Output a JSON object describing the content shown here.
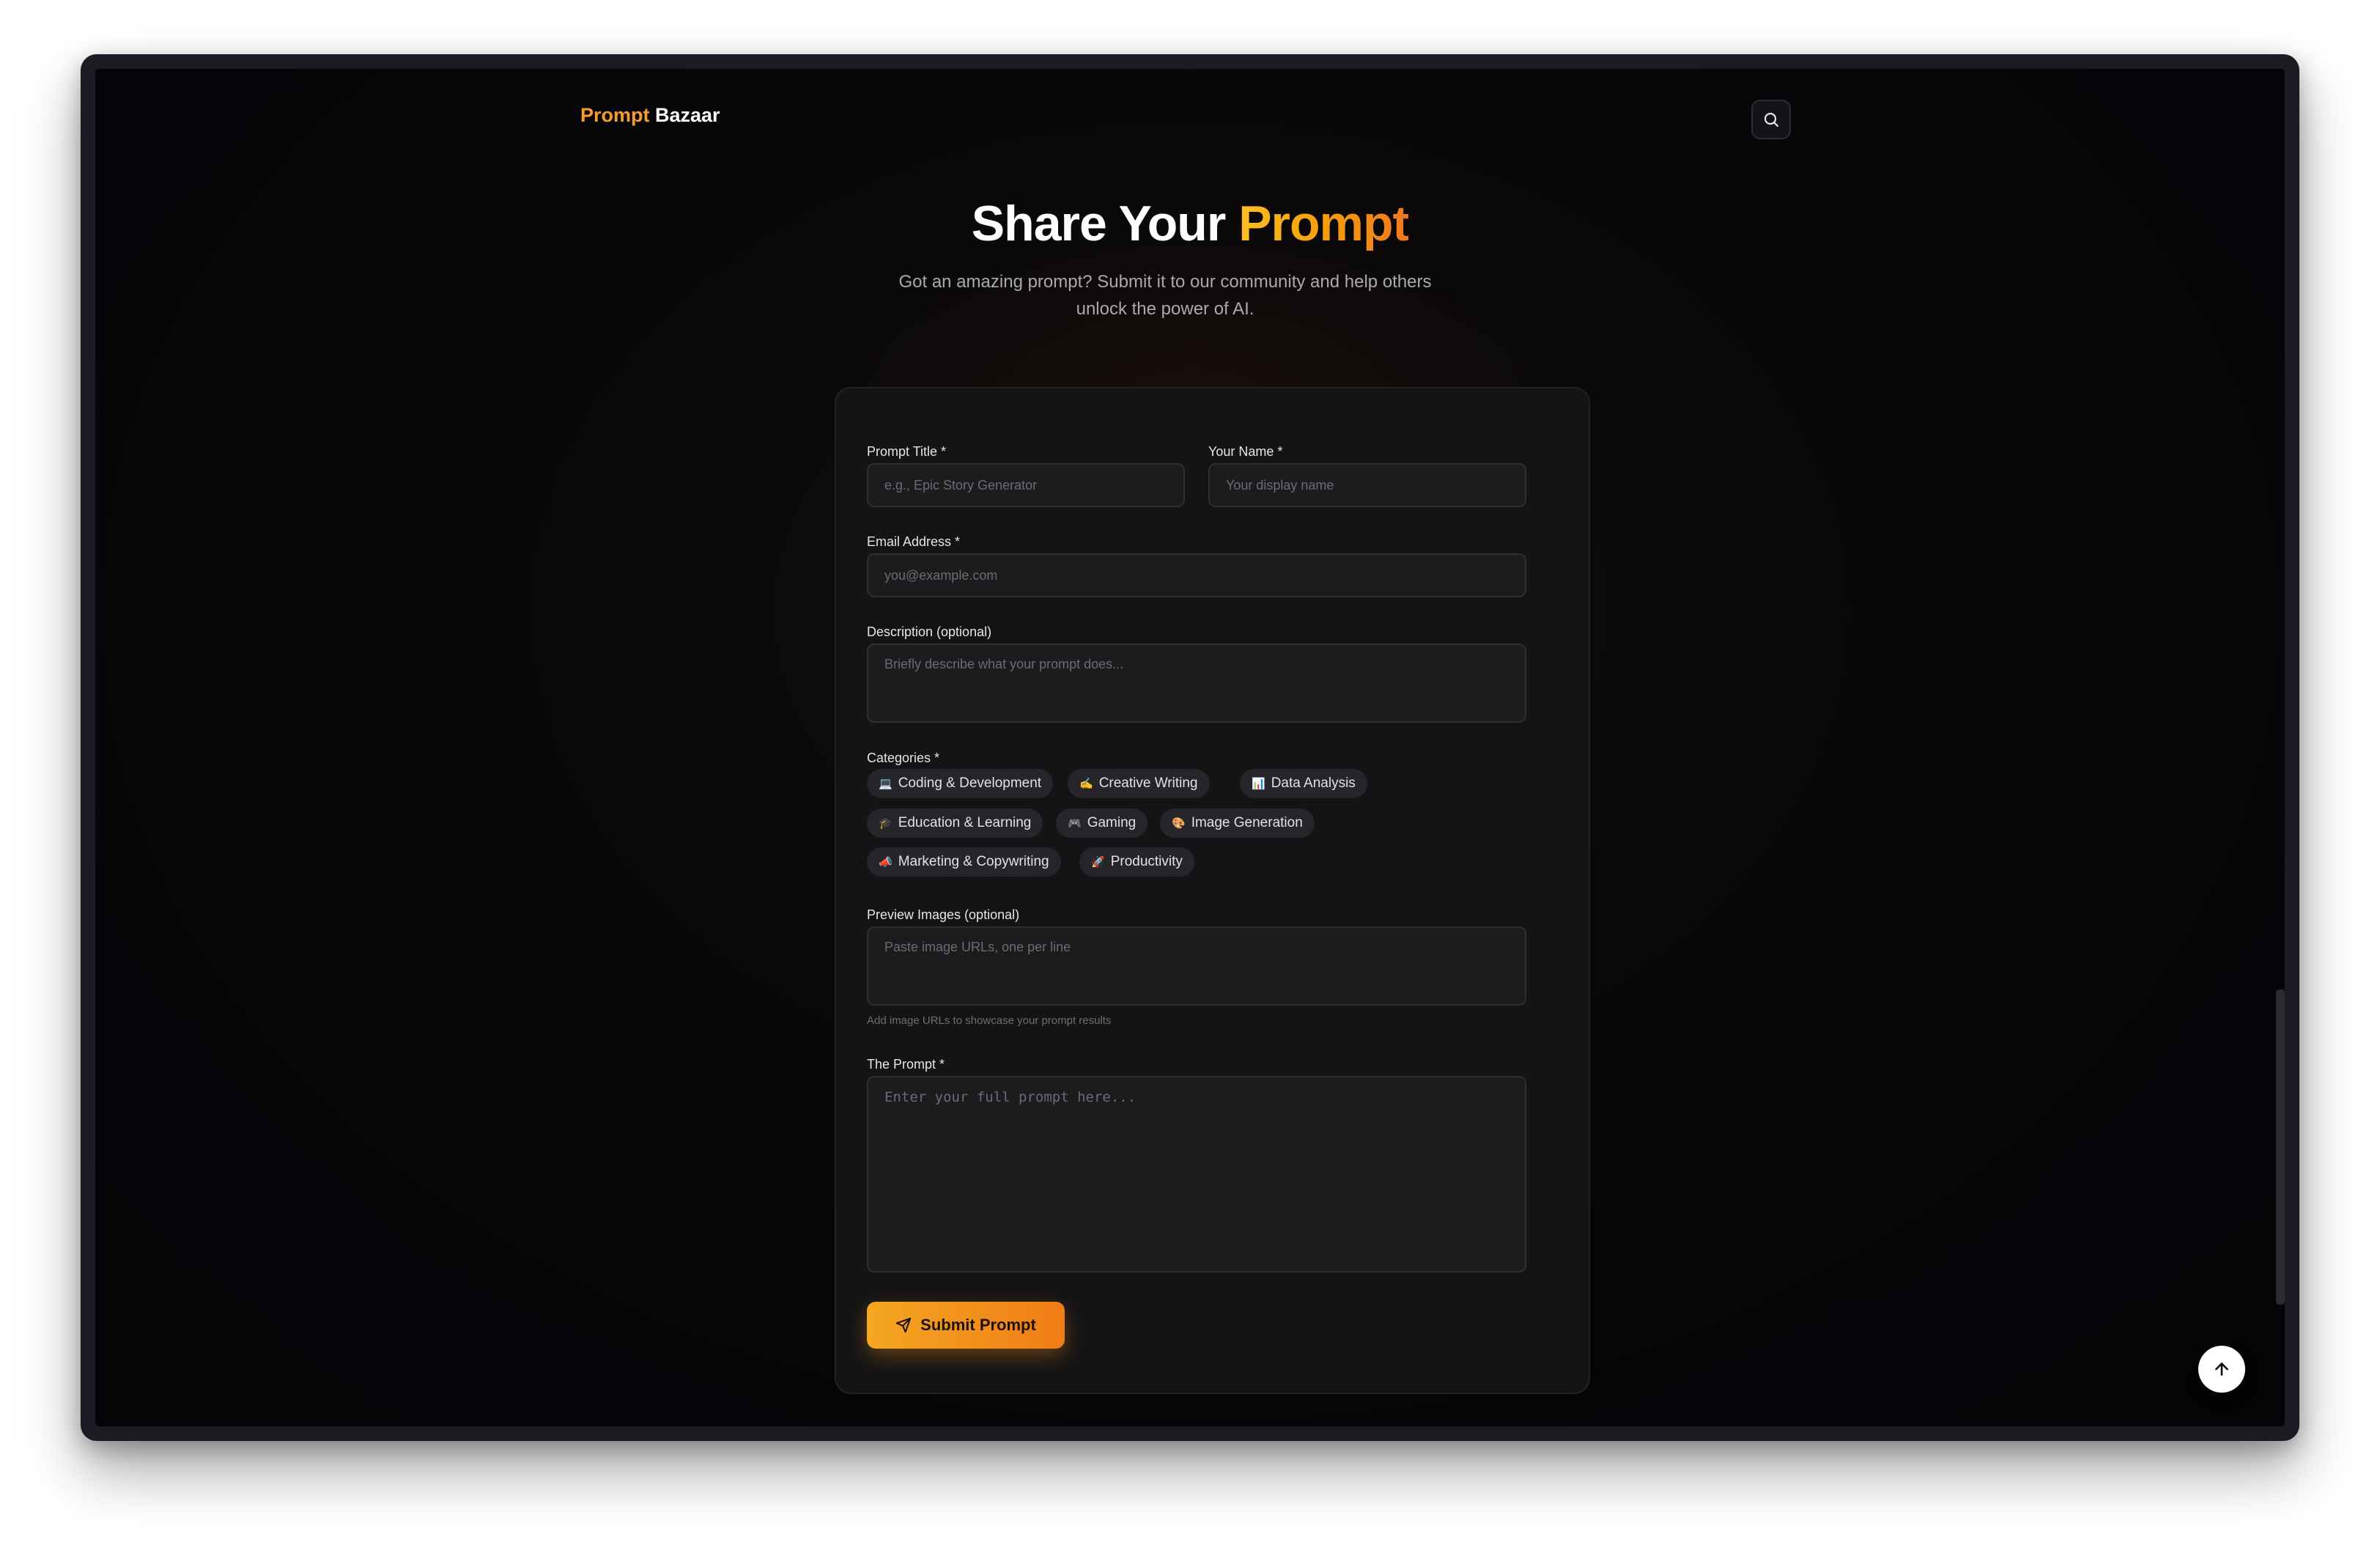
{
  "brand": {
    "name_accent": "Prompt",
    "name_rest": " Bazaar",
    "accent_color": "#f59e2b"
  },
  "header": {
    "search_icon": "search-icon"
  },
  "hero": {
    "title_plain": "Share Your ",
    "title_accent": "Prompt",
    "subtitle": "Got an amazing prompt? Submit it to our community and help others unlock the power of AI."
  },
  "form": {
    "title_label": "Prompt Title *",
    "title_placeholder": "e.g., Epic Story Generator",
    "name_label": "Your Name *",
    "name_placeholder": "Your display name",
    "email_label": "Email Address *",
    "email_placeholder": "you@example.com",
    "description_label": "Description (optional)",
    "description_placeholder": "Briefly describe what your prompt does...",
    "categories_label": "Categories *",
    "categories": [
      {
        "emoji": "💻",
        "label": "Coding & Development"
      },
      {
        "emoji": "✍️",
        "label": "Creative Writing"
      },
      {
        "emoji": "📊",
        "label": "Data Analysis"
      },
      {
        "emoji": "🎓",
        "label": "Education & Learning"
      },
      {
        "emoji": "🎮",
        "label": "Gaming"
      },
      {
        "emoji": "🎨",
        "label": "Image Generation"
      },
      {
        "emoji": "📣",
        "label": "Marketing & Copywriting"
      },
      {
        "emoji": "🚀",
        "label": "Productivity"
      }
    ],
    "images_label": "Preview Images (optional)",
    "images_placeholder": "Paste image URLs, one per line",
    "images_hint": "Add image URLs to showcase your prompt results",
    "prompt_label": "The Prompt *",
    "prompt_placeholder": "Enter your full prompt here...",
    "submit_label": "Submit Prompt",
    "submit_icon": "send-icon"
  },
  "floating": {
    "back_to_top_icon": "arrow-up-icon"
  },
  "colors": {
    "accent_start": "#f5a623",
    "accent_end": "#f07d14",
    "background": "#060508"
  }
}
